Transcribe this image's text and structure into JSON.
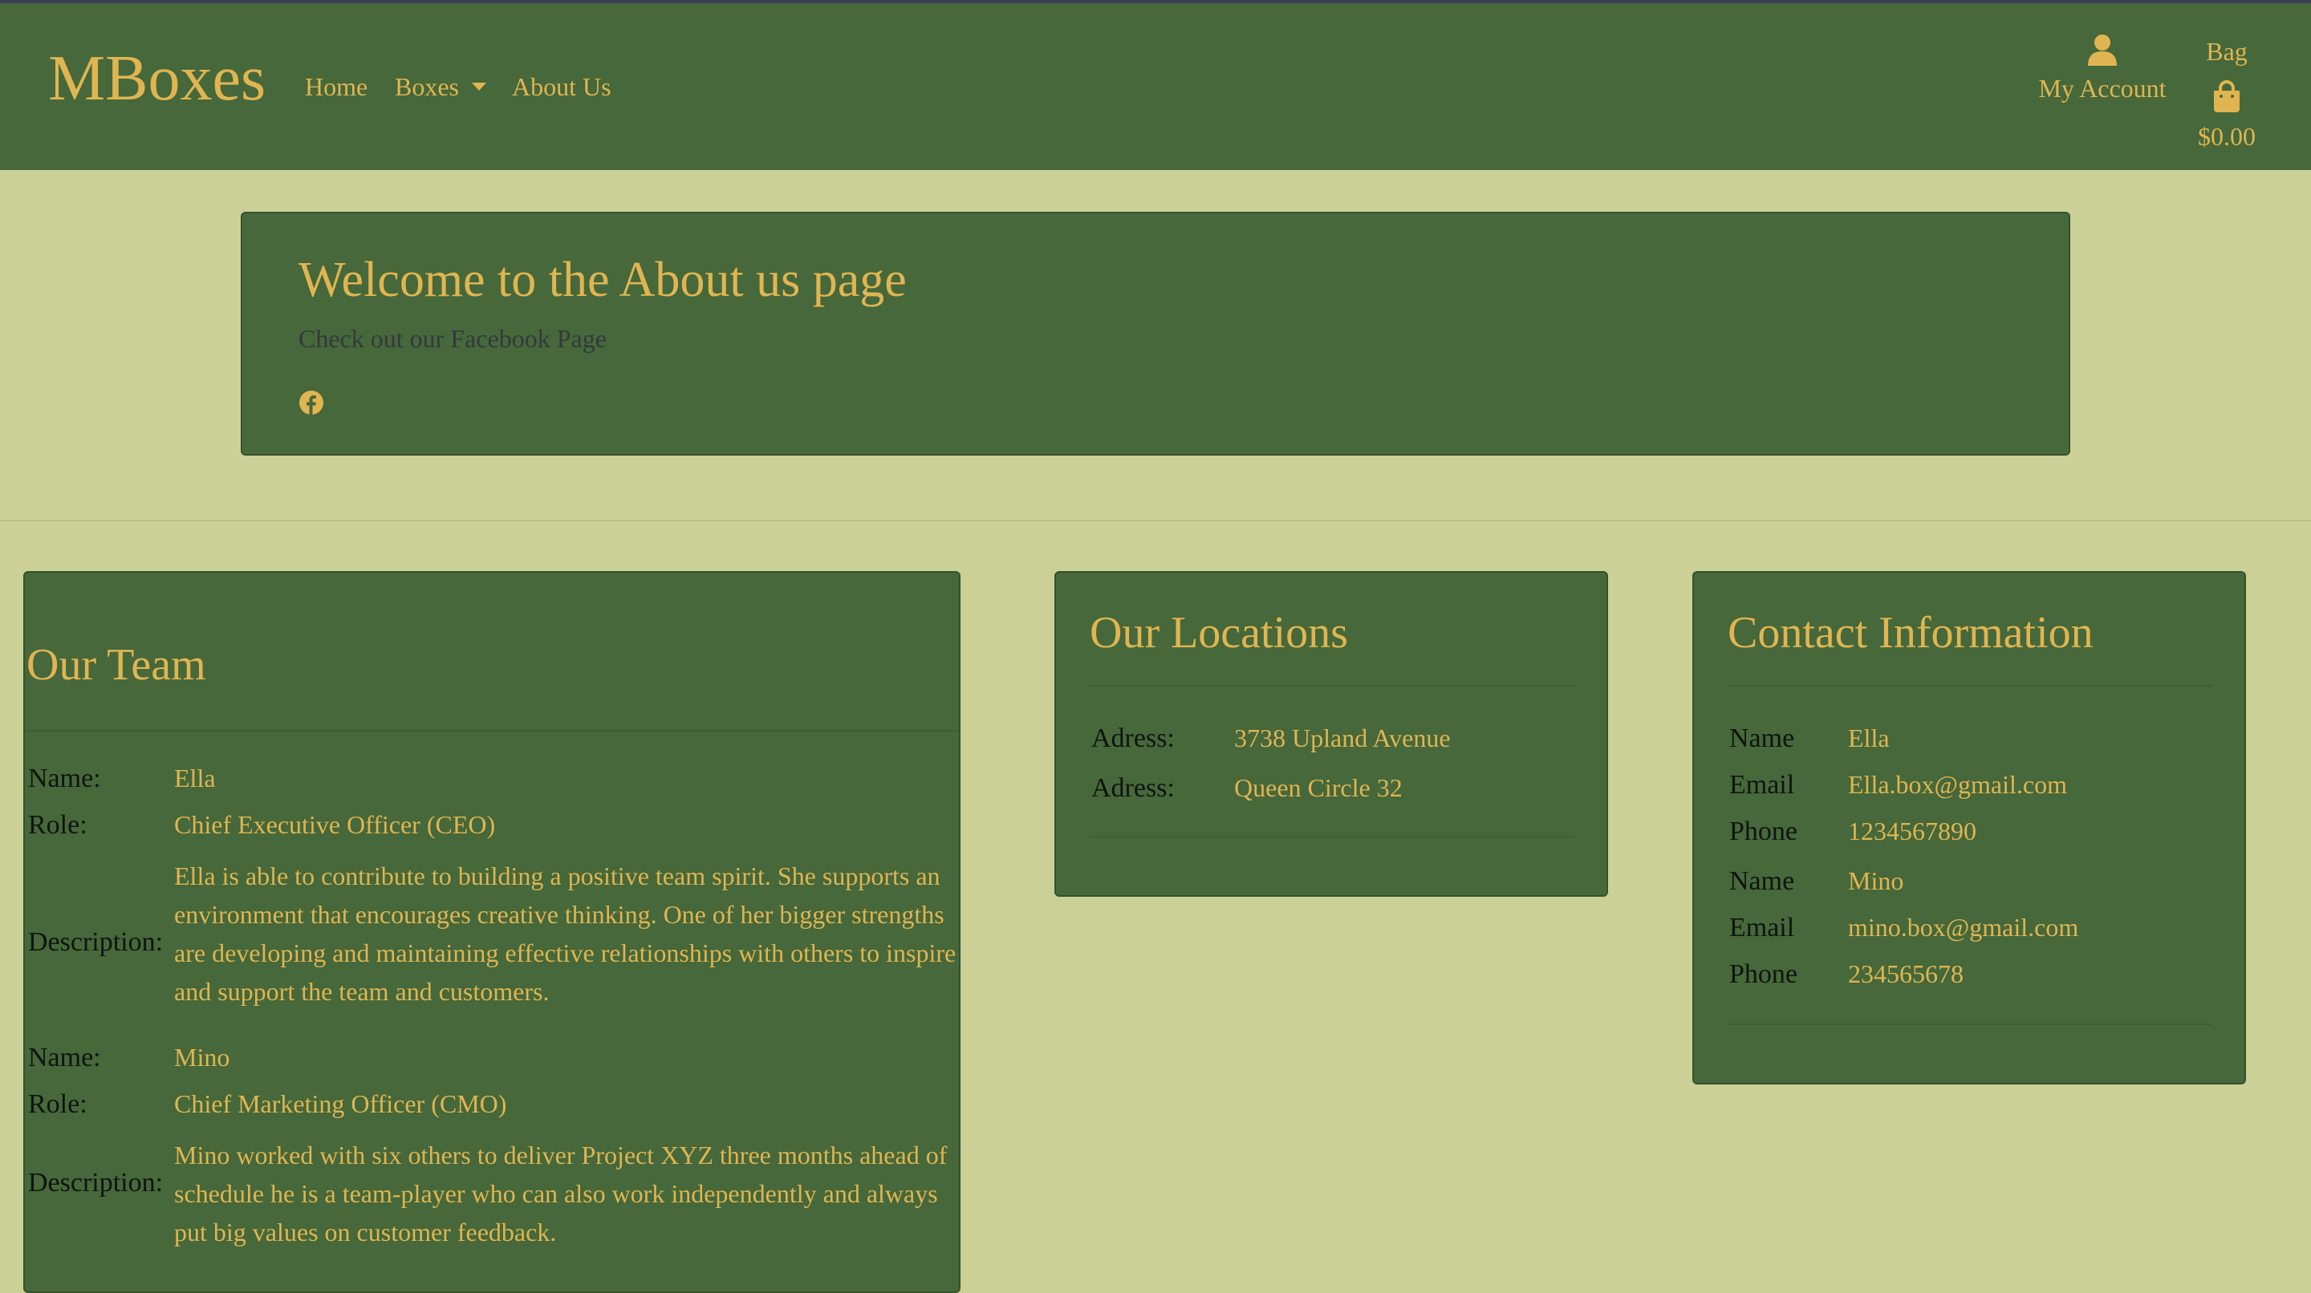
{
  "header": {
    "brand": "MBoxes",
    "nav": {
      "home": "Home",
      "boxes": "Boxes",
      "about": "About Us"
    },
    "account_label": "My Account",
    "bag_label": "Bag",
    "bag_total": "$0.00"
  },
  "jumbotron": {
    "title": "Welcome to the About us page",
    "subtitle": "Check out our Facebook Page",
    "icon": "facebook-icon"
  },
  "team": {
    "title": "Our Team",
    "labels": {
      "name": "Name:",
      "role": "Role:",
      "description": "Description:"
    },
    "members": [
      {
        "name": "Ella",
        "role": "Chief Executive Officer (CEO)",
        "description": "Ella is able to contribute to building a positive team spirit. She supports an environment that encourages creative thinking. One of her bigger strengths are developing and maintaining effective relationships with others to inspire and support the team and customers."
      },
      {
        "name": "Mino",
        "role": "Chief Marketing Officer (CMO)",
        "description": "Mino worked with six others to deliver Project XYZ three months ahead of schedule he is a team-player who can also work independently and always put big values on customer feedback."
      }
    ]
  },
  "locations": {
    "title": "Our Locations",
    "items": [
      {
        "label": "Adress:",
        "value": "3738 Upland Avenue"
      },
      {
        "label": "Adress:",
        "value": "Queen Circle 32"
      }
    ]
  },
  "contact": {
    "title": "Contact Information",
    "people": [
      {
        "name_label": "Name",
        "name": "Ella",
        "email_label": "Email",
        "email": "Ella.box@gmail.com",
        "phone_label": "Phone",
        "phone": "1234567890"
      },
      {
        "name_label": "Name",
        "name": "Mino",
        "email_label": "Email",
        "email": "mino.box@gmail.com",
        "phone_label": "Phone",
        "phone": "234565678"
      }
    ]
  },
  "colors": {
    "navbar": "#46683a",
    "background": "#cbd196",
    "accent": "#e0b551"
  }
}
